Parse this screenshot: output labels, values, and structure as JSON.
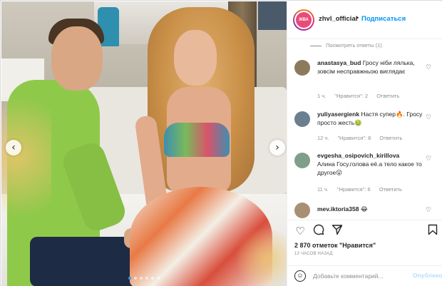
{
  "post": {
    "dots_count": 6,
    "active_dot": 0
  },
  "header": {
    "avatar_text": "ЖВА",
    "username": "zhvl_official",
    "separator": "•",
    "follow_label": "Подписаться"
  },
  "replies": {
    "view_replies_label": "Посмотреть ответы (1)"
  },
  "comments": [
    {
      "username": "anastasya_bud",
      "text": "Гросу ніби лялька, зовсім несправжньою виглядає",
      "time": "1 ч.",
      "likes": "\"Нравится\": 2",
      "reply": "Ответить",
      "avatar_color": "#8c7a5c"
    },
    {
      "username": "yuliyasergienk",
      "text": "Настя супер🔥. Гросу просто жесть🤢",
      "time": "12 ч.",
      "likes": "\"Нравится\": 8",
      "reply": "Ответить",
      "avatar_color": "#6a7f8f"
    },
    {
      "username": "evgesha_osipovich_kirillova",
      "text": "Алина Госу.голова её.а тело какое то другое😮",
      "time": "11 ч.",
      "likes": "\"Нравится\": 6",
      "reply": "Ответить",
      "avatar_color": "#7f9f8a"
    },
    {
      "username": "mev.iktoria358",
      "text": "😂",
      "time": "",
      "likes": "",
      "reply": "",
      "avatar_color": "#a89075"
    }
  ],
  "stats": {
    "likes_text": "2 870 отметок \"Нравится\"",
    "posted_ago": "13 часов назад"
  },
  "composer": {
    "placeholder": "Добавьте комментарий...",
    "publish_label": "Опубликовать"
  },
  "icons": {
    "like": "heart-icon",
    "comment": "comment-icon",
    "share": "share-icon",
    "save": "bookmark-icon",
    "emoji": "emoji-icon",
    "prev": "chevron-left-icon",
    "next": "chevron-right-icon"
  },
  "colors": {
    "accent": "#0095f6",
    "muted": "#8e8e8e",
    "publish_disabled": "#b2dffc",
    "active_dot": "#3897f0"
  }
}
